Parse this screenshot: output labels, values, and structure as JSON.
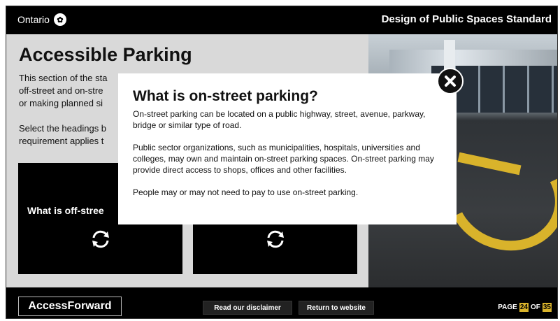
{
  "header": {
    "logo_text": "Ontario",
    "course_title": "Design of Public Spaces Standard"
  },
  "main": {
    "title": "Accessible Parking",
    "intro_lines": [
      "This section of the sta",
      "off-street and on-stre",
      "or making planned si"
    ],
    "instruction_lines": [
      "Select the headings b",
      "requirement applies t"
    ],
    "cards": [
      {
        "label": "What is off-stree"
      },
      {
        "label": ""
      }
    ]
  },
  "modal": {
    "title": "What is on-street parking?",
    "paragraphs": [
      "On-street parking can be located on a public highway, street, avenue, parkway, bridge or similar type of road.",
      "Public sector organizations, such as municipalities, hospitals, universities and colleges, may own and maintain on-street parking spaces. On-street parking may provide direct access to shops, offices and other facilities.",
      "People may or may not need to pay to use on-street parking."
    ],
    "close_icon": "close-icon"
  },
  "footer": {
    "brand": "AccessForward",
    "disclaimer_label": "Read our disclaimer",
    "return_label": "Return to website",
    "page_prefix": "PAGE",
    "page_current": "24",
    "page_of": "OF",
    "page_total": "35"
  },
  "colors": {
    "accent": "#d9b32b",
    "background": "#000000",
    "panel": "#d9d9d9"
  }
}
